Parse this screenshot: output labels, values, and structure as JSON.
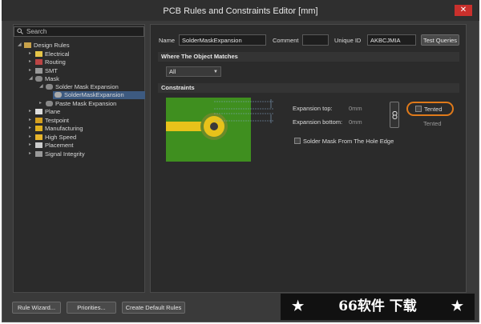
{
  "window": {
    "title": "PCB Rules and Constraints Editor [mm]",
    "close_symbol": "✕"
  },
  "search": {
    "placeholder": "Search"
  },
  "tree": {
    "root": "Design Rules",
    "items": [
      {
        "label": "Electrical"
      },
      {
        "label": "Routing"
      },
      {
        "label": "SMT"
      },
      {
        "label": "Mask"
      },
      {
        "label": "Solder Mask Expansion"
      },
      {
        "label": "SolderMaskExpansion"
      },
      {
        "label": "Paste Mask Expansion"
      },
      {
        "label": "Plane"
      },
      {
        "label": "Testpoint"
      },
      {
        "label": "Manufacturing"
      },
      {
        "label": "High Speed"
      },
      {
        "label": "Placement"
      },
      {
        "label": "Signal Integrity"
      }
    ]
  },
  "rule": {
    "name_label": "Name",
    "name_value": "SolderMaskExpansion",
    "comment_label": "Comment",
    "comment_value": "",
    "uid_label": "Unique ID",
    "uid_value": "AKBCJMIA",
    "test_queries": "Test Queries"
  },
  "where": {
    "header": "Where The Object Matches",
    "select_value": "All"
  },
  "constraints": {
    "header": "Constraints",
    "expansion_top_label": "Expansion top:",
    "expansion_top_value": "0mm",
    "expansion_bottom_label": "Expansion bottom:",
    "expansion_bottom_value": "0mm",
    "tented_label": "Tented",
    "tented_label_2": "Tented",
    "solder_mask_hole_label": "Solder Mask From The Hole Edge"
  },
  "footer": {
    "rule_wizard": "Rule Wizard...",
    "priorities": "Priorities...",
    "create_default": "Create Default Rules"
  },
  "watermark": {
    "text": "66软件 下载",
    "star": "★"
  },
  "colors": {
    "accent_orange": "#e07a1a",
    "board_green": "#3f8f1f",
    "selection_blue": "#3d5a80",
    "close_red": "#c9302c"
  }
}
